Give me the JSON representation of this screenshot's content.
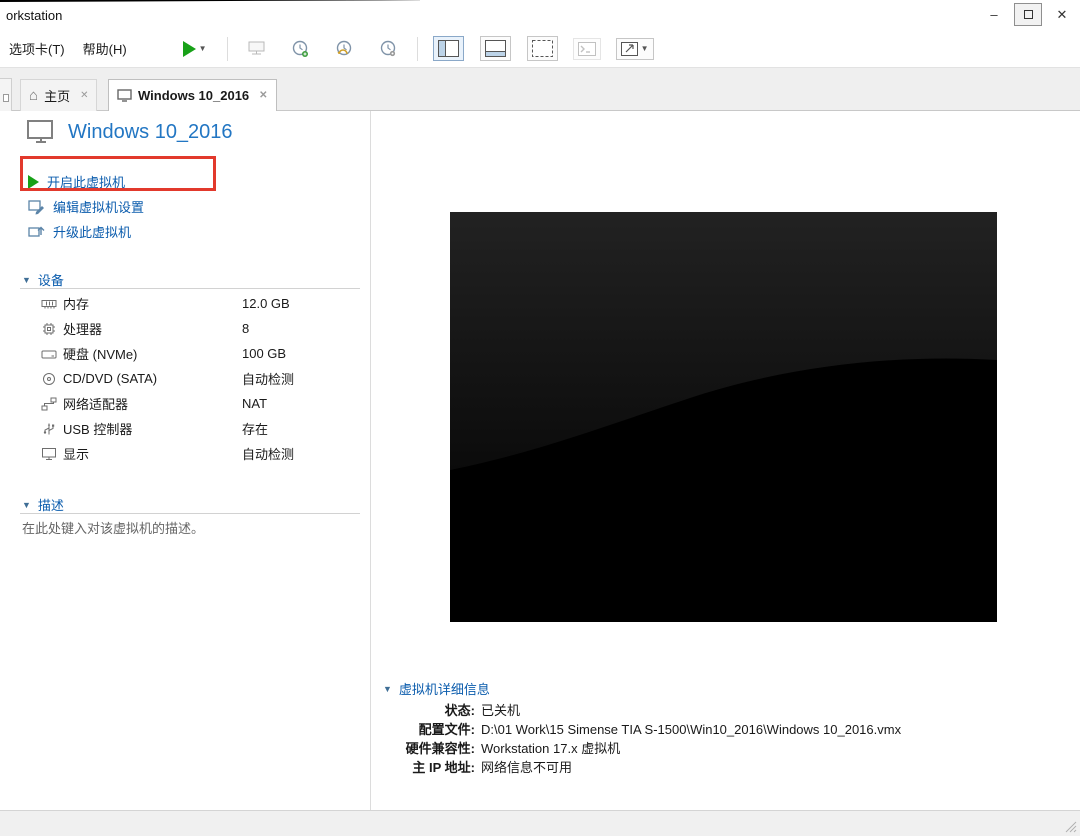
{
  "window": {
    "title": "orkstation",
    "minimize_glyph": "–",
    "close_glyph": "✕"
  },
  "menubar": {
    "tabs_menu": "选项卡(T)",
    "help_menu": "帮助(H)"
  },
  "tabs": {
    "home": {
      "label": "主页",
      "close_glyph": "✕"
    },
    "vm": {
      "label": "Windows 10_2016",
      "close_glyph": "✕"
    }
  },
  "vm": {
    "title": "Windows 10_2016",
    "actions": {
      "power_on": "开启此虚拟机",
      "edit_settings": "编辑虚拟机设置",
      "upgrade": "升级此虚拟机"
    },
    "devices": {
      "header": "设备",
      "items": [
        {
          "icon": "memory-icon",
          "name": "内存",
          "value": "12.0 GB"
        },
        {
          "icon": "cpu-icon",
          "name": "处理器",
          "value": "8"
        },
        {
          "icon": "disk-icon",
          "name": "硬盘 (NVMe)",
          "value": "100 GB"
        },
        {
          "icon": "cd-dvd-icon",
          "name": "CD/DVD (SATA)",
          "value": "自动检测"
        },
        {
          "icon": "network-adapter-icon",
          "name": "网络适配器",
          "value": "NAT"
        },
        {
          "icon": "usb-controller-icon",
          "name": "USB 控制器",
          "value": "存在"
        },
        {
          "icon": "display-icon",
          "name": "显示",
          "value": "自动检测"
        }
      ]
    },
    "description": {
      "header": "描述",
      "text": "在此处键入对该虚拟机的描述。"
    },
    "details": {
      "header": "虚拟机详细信息",
      "rows": [
        {
          "label": "状态:",
          "value": "已关机"
        },
        {
          "label": "配置文件:",
          "value": "D:\\01 Work\\15 Simense TIA S-1500\\Win10_2016\\Windows 10_2016.vmx"
        },
        {
          "label": "硬件兼容性:",
          "value": "Workstation 17.x 虚拟机"
        },
        {
          "label": "主 IP 地址:",
          "value": "网络信息不可用"
        }
      ]
    }
  },
  "colors": {
    "link_blue": "#0b5cad",
    "title_blue": "#2276c3",
    "annotation_red": "#e2392c",
    "play_green": "#18a118"
  }
}
